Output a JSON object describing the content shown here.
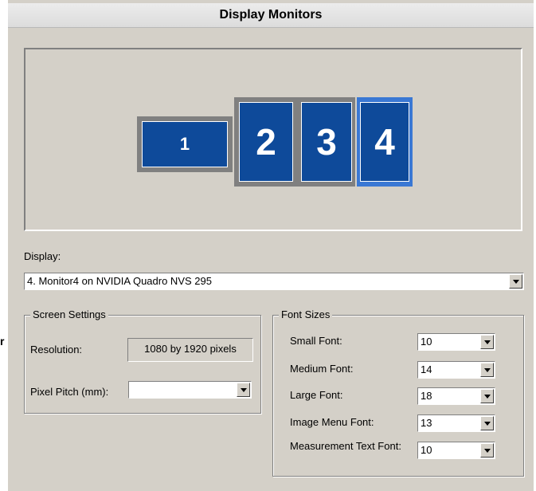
{
  "header": {
    "title": "Display Monitors"
  },
  "stray_char": "r",
  "monitors": [
    {
      "id": "1",
      "selected": false
    },
    {
      "id": "2",
      "selected": false
    },
    {
      "id": "3",
      "selected": false
    },
    {
      "id": "4",
      "selected": true
    }
  ],
  "display": {
    "label": "Display:",
    "value": "4. Monitor4 on NVIDIA Quadro NVS 295"
  },
  "screen_settings": {
    "title": "Screen Settings",
    "resolution_label": "Resolution:",
    "resolution_value": "1080 by 1920 pixels",
    "pixel_pitch_label": "Pixel Pitch (mm):",
    "pixel_pitch_value": ""
  },
  "font_sizes": {
    "title": "Font Sizes",
    "rows": [
      {
        "label": "Small Font:",
        "value": "10"
      },
      {
        "label": "Medium Font:",
        "value": "14"
      },
      {
        "label": "Large Font:",
        "value": "18"
      },
      {
        "label": "Image Menu Font:",
        "value": "13"
      },
      {
        "label": "Measurement Text Font:",
        "value": "10"
      }
    ]
  },
  "colors": {
    "monitor_face": "#0e4a9a",
    "selected_border": "#3a78d4",
    "panel": "#d4d0c8"
  }
}
